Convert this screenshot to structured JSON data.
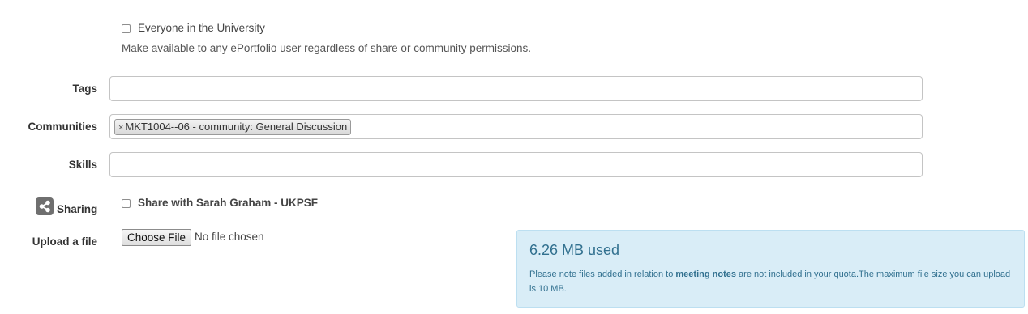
{
  "visibility": {
    "everyone_label": "Everyone in the University",
    "everyone_help": "Make available to any ePortfolio user regardless of share or community permissions."
  },
  "fields": {
    "tags_label": "Tags",
    "tags_value": "",
    "communities_label": "Communities",
    "communities_tags": [
      {
        "remove": "×",
        "text": "MKT1004--06 - community: General Discussion"
      }
    ],
    "skills_label": "Skills",
    "skills_value": ""
  },
  "sharing": {
    "label": "Sharing",
    "icon": "share-icon",
    "option_label": "Share with Sarah Graham - UKPSF"
  },
  "upload": {
    "label": "Upload a file",
    "button_label": "Choose File",
    "status": "No file chosen"
  },
  "quota": {
    "used": "6.26 MB used",
    "note_before": "Please note files added in relation to ",
    "note_bold": "meeting notes",
    "note_after": " are not included in your quota.The maximum file size you can upload is 10 MB.",
    "bg_color": "#d9edf7",
    "text_color": "#31708f"
  }
}
